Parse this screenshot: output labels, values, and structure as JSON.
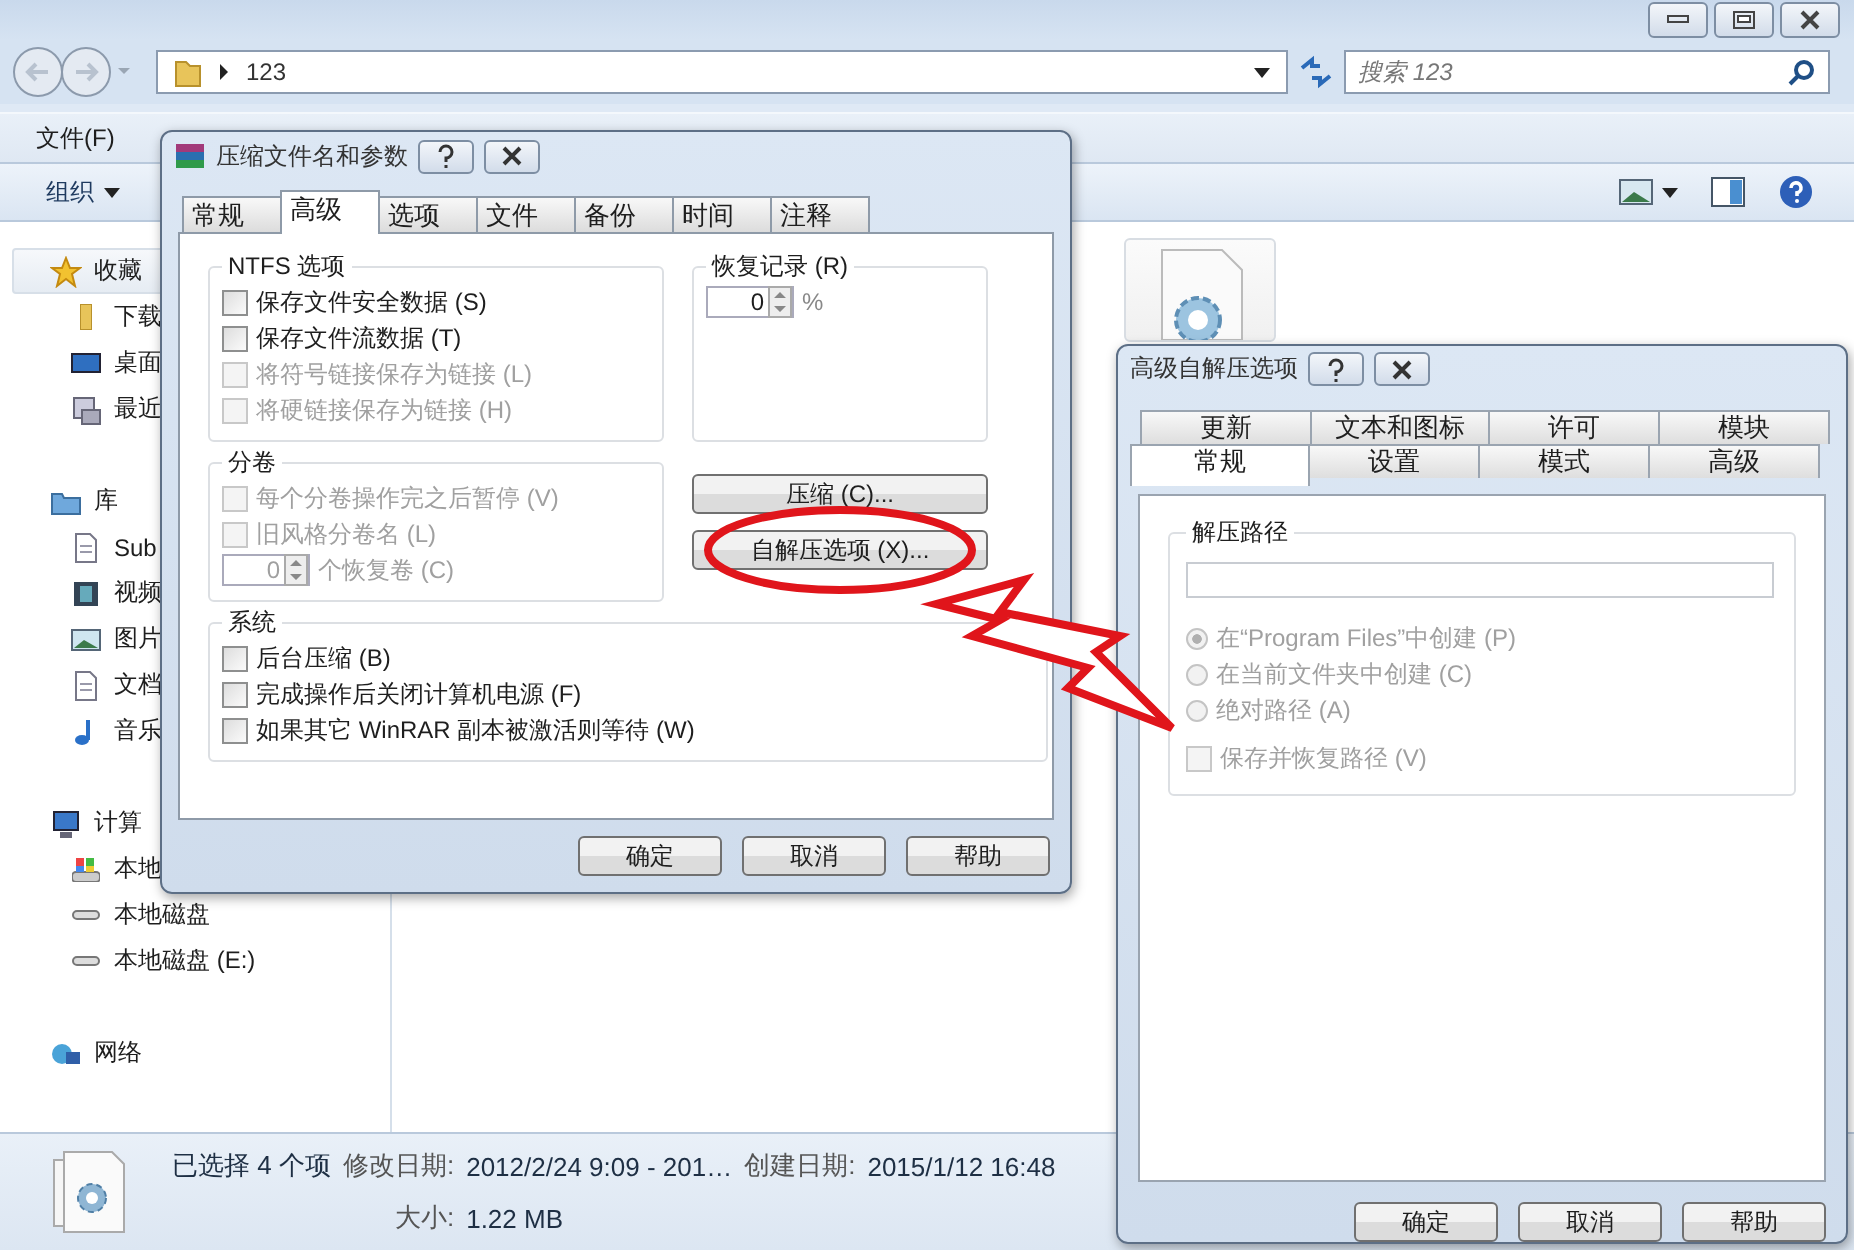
{
  "explorer": {
    "address": "123",
    "search": {
      "placeholder": "搜索 123"
    },
    "menu": [
      "文件(F)"
    ],
    "toolbar": {
      "organize": "组织"
    },
    "sidebar": [
      {
        "label": "收藏",
        "kind": "star",
        "children": [
          {
            "label": "下载",
            "kind": "folder"
          },
          {
            "label": "桌面",
            "kind": "desktop"
          },
          {
            "label": "最近",
            "kind": "recent"
          }
        ]
      },
      {
        "label": "库",
        "kind": "library",
        "children": [
          {
            "label": "Sub",
            "kind": "document"
          },
          {
            "label": "视频",
            "kind": "video"
          },
          {
            "label": "图片",
            "kind": "picture"
          },
          {
            "label": "文档",
            "kind": "document"
          },
          {
            "label": "音乐",
            "kind": "music"
          }
        ]
      },
      {
        "label": "计算",
        "kind": "computer",
        "children": [
          {
            "label": "本地",
            "kind": "sysdrive"
          },
          {
            "label": "本地磁盘",
            "kind": "drive"
          },
          {
            "label": "本地磁盘 (E:)",
            "kind": "drive"
          }
        ]
      },
      {
        "label": "网络",
        "kind": "network"
      }
    ],
    "status": {
      "selection": "已选择 4 个项",
      "fields": [
        {
          "label": "修改日期:",
          "value": "2012/2/24 9:09 - 201…"
        },
        {
          "label": "创建日期:",
          "value": "2015/1/12 16:48"
        },
        {
          "label": "大小:",
          "value": "1.22 MB"
        }
      ]
    }
  },
  "archive_dialog": {
    "title": "压缩文件名和参数",
    "tabs": [
      {
        "label": "常规",
        "selected": false
      },
      {
        "label": "高级",
        "selected": true
      },
      {
        "label": "选项",
        "selected": false
      },
      {
        "label": "文件",
        "selected": false
      },
      {
        "label": "备份",
        "selected": false
      },
      {
        "label": "时间",
        "selected": false
      },
      {
        "label": "注释",
        "selected": false
      }
    ],
    "ntfs": {
      "title": "NTFS 选项",
      "options": [
        {
          "label": "保存文件安全数据 (S)",
          "checked": false,
          "disabled": false
        },
        {
          "label": "保存文件流数据 (T)",
          "checked": false,
          "disabled": false
        },
        {
          "label": "将符号链接保存为链接 (L)",
          "checked": false,
          "disabled": true
        },
        {
          "label": "将硬链接保存为链接 (H)",
          "checked": false,
          "disabled": true
        }
      ]
    },
    "recovery": {
      "title": "恢复记录 (R)",
      "value": "0",
      "unit": "%"
    },
    "volumes": {
      "title": "分卷",
      "options": [
        {
          "label": "每个分卷操作完之后暂停 (V)",
          "checked": false,
          "disabled": true
        },
        {
          "label": "旧风格分卷名 (L)",
          "checked": false,
          "disabled": true
        }
      ],
      "spinner": {
        "value": "0",
        "label": "个恢复卷 (C)",
        "disabled": true
      }
    },
    "actions": [
      "压缩 (C)...",
      "自解压选项 (X)..."
    ],
    "system": {
      "title": "系统",
      "options": [
        {
          "label": "后台压缩 (B)",
          "checked": false,
          "disabled": false
        },
        {
          "label": "完成操作后关闭计算机电源 (F)",
          "checked": false,
          "disabled": false
        },
        {
          "label": "如果其它 WinRAR 副本被激活则等待 (W)",
          "checked": false,
          "disabled": false
        }
      ]
    },
    "buttons": [
      "确定",
      "取消",
      "帮助"
    ]
  },
  "sfx_dialog": {
    "title": "高级自解压选项",
    "tab_rows": [
      {
        "tabs": [
          {
            "label": "更新",
            "selected": false
          },
          {
            "label": "文本和图标",
            "selected": false
          },
          {
            "label": "许可",
            "selected": false
          },
          {
            "label": "模块",
            "selected": false
          }
        ]
      },
      {
        "tabs": [
          {
            "label": "常规",
            "selected": true
          },
          {
            "label": "设置",
            "selected": false
          },
          {
            "label": "模式",
            "selected": false
          },
          {
            "label": "高级",
            "selected": false
          }
        ]
      }
    ],
    "group": {
      "title": "解压路径"
    },
    "radios": [
      {
        "label": "在“Program Files”中创建 (P)",
        "selected": true,
        "disabled": true
      },
      {
        "label": "在当前文件夹中创建 (C)",
        "selected": false,
        "disabled": true
      },
      {
        "label": "绝对路径 (A)",
        "selected": false,
        "disabled": true
      }
    ],
    "options": [
      {
        "label": "保存并恢复路径 (V)",
        "checked": false,
        "disabled": true
      }
    ],
    "buttons": [
      "确定",
      "取消",
      "帮助"
    ]
  }
}
